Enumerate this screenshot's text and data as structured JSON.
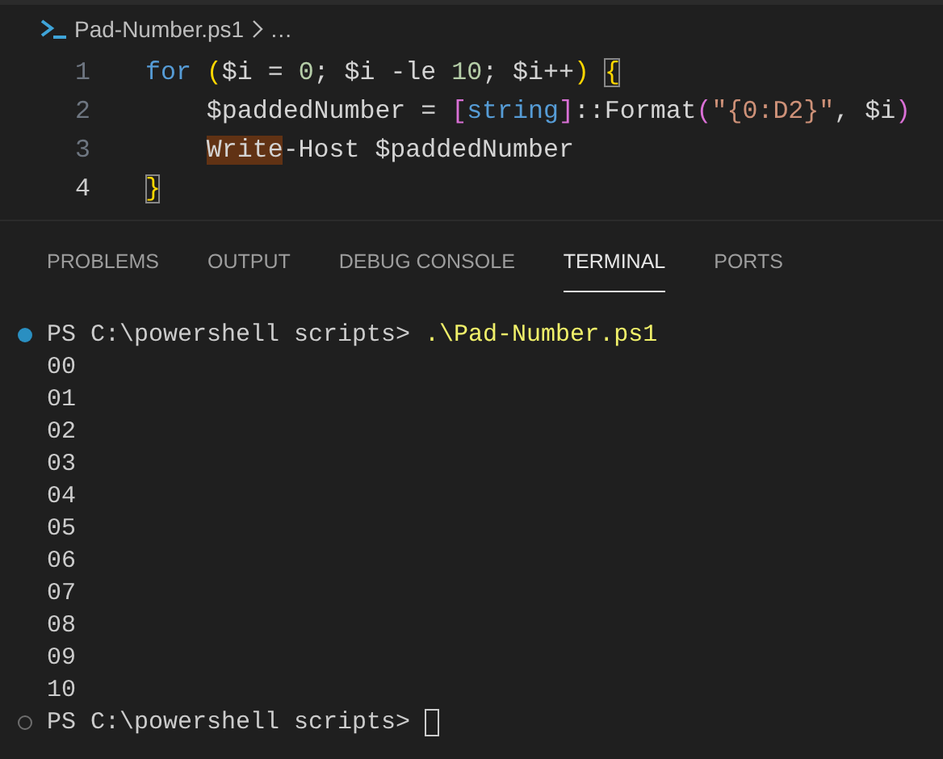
{
  "breadcrumb": {
    "file": "Pad-Number.ps1",
    "more": "…"
  },
  "editor": {
    "lines": [
      {
        "number": "1",
        "current": false,
        "tokens": [
          {
            "kind": "keyword",
            "text": "for "
          },
          {
            "kind": "bracket1",
            "text": "("
          },
          {
            "kind": "plain",
            "text": "$i = "
          },
          {
            "kind": "number",
            "text": "0"
          },
          {
            "kind": "plain",
            "text": "; $i -le "
          },
          {
            "kind": "number",
            "text": "10"
          },
          {
            "kind": "plain",
            "text": "; $i++"
          },
          {
            "kind": "bracket1",
            "text": ") "
          },
          {
            "kind": "bracket1",
            "text": "{",
            "matched": true
          }
        ]
      },
      {
        "number": "2",
        "current": false,
        "tokens": [
          {
            "kind": "plain",
            "text": "    $paddedNumber = "
          },
          {
            "kind": "bracket2",
            "text": "["
          },
          {
            "kind": "type",
            "text": "string"
          },
          {
            "kind": "bracket2",
            "text": "]"
          },
          {
            "kind": "plain",
            "text": "::Format"
          },
          {
            "kind": "bracket2",
            "text": "("
          },
          {
            "kind": "string",
            "text": "\"{0:D2}\""
          },
          {
            "kind": "plain",
            "text": ", $i"
          },
          {
            "kind": "bracket2",
            "text": ")"
          }
        ]
      },
      {
        "number": "3",
        "current": false,
        "indented": true,
        "tokens": [
          {
            "kind": "plain",
            "text": "Write",
            "highlighted": true
          },
          {
            "kind": "plain",
            "text": "-Host $paddedNumber"
          }
        ]
      },
      {
        "number": "4",
        "current": true,
        "tokens": [
          {
            "kind": "bracket1",
            "text": "}",
            "matched": true
          }
        ]
      }
    ]
  },
  "panel_tabs": [
    {
      "label": "PROBLEMS",
      "selected": false
    },
    {
      "label": "OUTPUT",
      "selected": false
    },
    {
      "label": "DEBUG CONSOLE",
      "selected": false
    },
    {
      "label": "TERMINAL",
      "selected": true
    },
    {
      "label": "PORTS",
      "selected": false
    }
  ],
  "terminal": {
    "lines": [
      {
        "kind": "prompt",
        "succeeded": true,
        "prompt": "PS C:\\powershell scripts> ",
        "command": ".\\Pad-Number.ps1"
      },
      {
        "kind": "output",
        "text": "00"
      },
      {
        "kind": "output",
        "text": "01"
      },
      {
        "kind": "output",
        "text": "02"
      },
      {
        "kind": "output",
        "text": "03"
      },
      {
        "kind": "output",
        "text": "04"
      },
      {
        "kind": "output",
        "text": "05"
      },
      {
        "kind": "output",
        "text": "06"
      },
      {
        "kind": "output",
        "text": "07"
      },
      {
        "kind": "output",
        "text": "08"
      },
      {
        "kind": "output",
        "text": "09"
      },
      {
        "kind": "output",
        "text": "10"
      },
      {
        "kind": "prompt",
        "succeeded": false,
        "prompt": "PS C:\\powershell scripts> ",
        "cursor": true
      }
    ]
  }
}
